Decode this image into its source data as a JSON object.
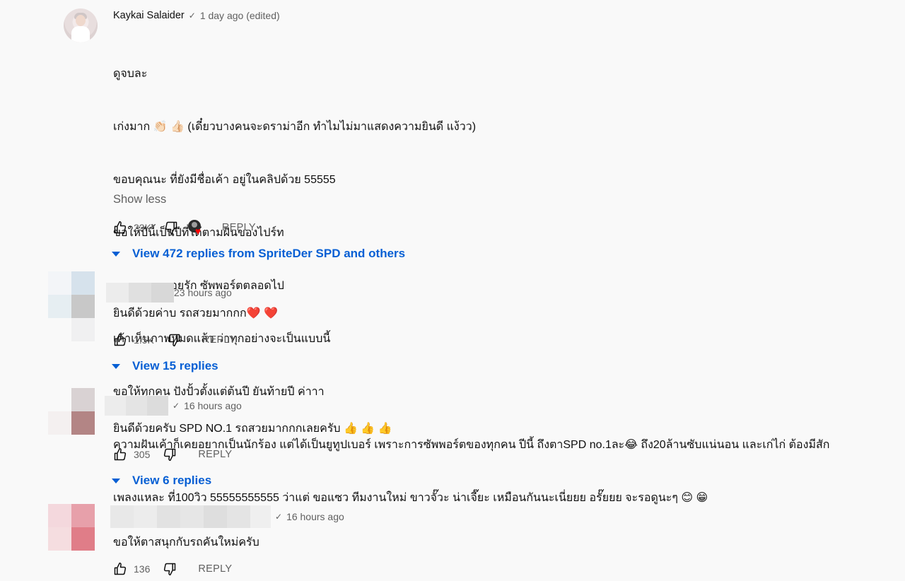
{
  "comments": [
    {
      "author": "Kaykai Salaider",
      "verified_mark": "✓",
      "time": "1 day ago (edited)",
      "text_lines": [
        "ดูจบละ",
        "เก่งมาก 👏🏻 👍🏻 (เดี๋ยวบางคนจะดราม่าอีก ทำไมไม่มาแสดงความยินดี แง้วว)",
        "ขอบคุณนะ ที่ยังมีชื่อเค้า อยู่ในคลิปด้วย 55555",
        "ขอให้ปีนี้เป็นปีที่ได้ตามฝันของไปร์ท",
        "และทุกคนคอยรัก ซัพพอร์ตตลอดไป",
        "เค้าเห็นภาพหมดแล้ว ว่าทุกอย่างจะเป็นแบบนี้",
        "ขอให้ทุกคน ปังปั้วตั้งแต่ต้นปี ยันท้ายปี ค่าาา",
        "ความฝันเค้าก็เคยอยากเป็นนักร้อง แต่ได้เป็นยูทูปเบอร์ เพราะการซัพพอร์ตของทุกคน ปีนี้ ถึงตาSPD no.1ละ😂 ถึง20ล้านซับแน่นอน และเก่ไก่ ต้องมีสัก",
        "เพลงแหละ ที่100วิว 55555555555 ว่าแต่ ขอแซว ทีมงานใหม่ ขาวจั๊วะ น่าเจี๊ยะ เหมือนกันนะเนี่ยยย อรั๊ยยย จะรอดูนะๆ 😊 😁"
      ],
      "show_less": "Show less",
      "likes": "23K",
      "reply_label": "REPLY",
      "view_replies": "View 472 replies from SpriteDer SPD and others"
    },
    {
      "author": "",
      "time": "23 hours ago",
      "text": "ยินดีด้วยค่าบ รถสวยมากกก❤️ ❤️",
      "likes": "1.5K",
      "reply_label": "REPLY",
      "view_replies": "View 15 replies"
    },
    {
      "author": "",
      "verified_mark": "✓",
      "time": "16 hours ago",
      "text": "ยินดีด้วยครับ SPD NO.1 รถสวยมากกกเลยครับ 👍 👍 👍",
      "likes": "305",
      "reply_label": "REPLY",
      "view_replies": "View 6 replies"
    },
    {
      "author": "",
      "verified_mark": "✓",
      "time": "16 hours ago",
      "text": "ขอให้ตาสนุกกับรถคันใหม่ครับ",
      "likes": "136",
      "reply_label": "REPLY"
    }
  ],
  "icons": {
    "like": "thumbs-up-icon",
    "dislike": "thumbs-down-icon",
    "creator_heart": "creator-heart-icon",
    "expand": "caret-down-icon"
  },
  "colors": {
    "background": "#f9f9f9",
    "link_blue": "#065fd4",
    "secondary_text": "#606060",
    "heart_red": "#ff0000"
  }
}
